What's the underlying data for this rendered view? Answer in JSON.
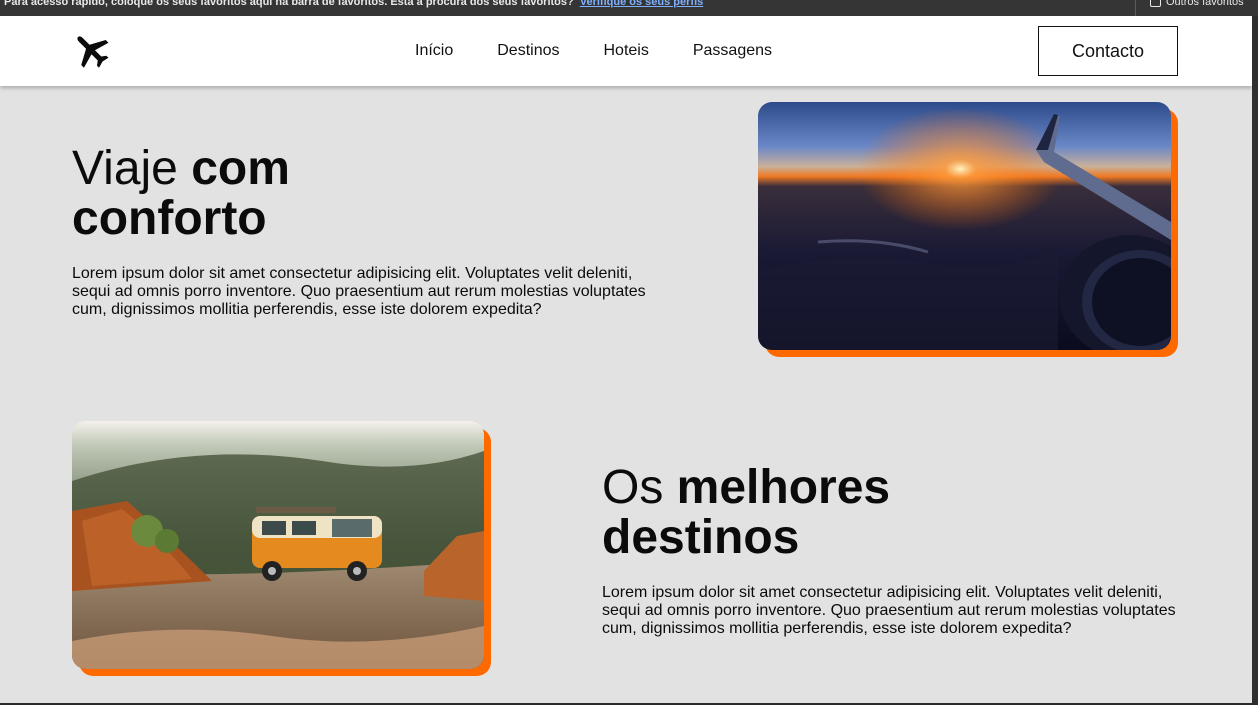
{
  "bookmarks_bar": {
    "message": "Para acesso rápido, coloque os seus favoritos aqui na barra de favoritos. Está à procura dos seus favoritos?",
    "link": "Verifique os seus perfis",
    "others": "Outros favoritos"
  },
  "nav": {
    "logo": "airplane-icon",
    "items": [
      {
        "label": "Início"
      },
      {
        "label": "Destinos"
      },
      {
        "label": "Hoteis"
      },
      {
        "label": "Passagens"
      }
    ],
    "contact_label": "Contacto"
  },
  "section1": {
    "title_light": "Viaje ",
    "title_bold": "com conforto",
    "text": "Lorem ipsum dolor sit amet consectetur adipisicing elit. Voluptates velit deleniti, sequi ad omnis porro inventore. Quo praesentium aut rerum molestias voluptates cum, dignissimos mollitia perferendis, esse iste dolorem expedita?",
    "image": "airplane-window-sunset-photo"
  },
  "section2": {
    "title_light": "Os ",
    "title_bold": "melhores destinos",
    "text": "Lorem ipsum dolor sit amet consectetur adipisicing elit. Voluptates velit deleniti, sequi ad omnis porro inventore. Quo praesentium aut rerum molestias voluptates cum, dignissimos mollitia perferendis, esse iste dolorem expedita?",
    "image": "orange-van-in-mountains-photo"
  },
  "colors": {
    "accent": "#ff6a00",
    "page_bg": "#e2e2e2",
    "header_bg": "#ffffff"
  }
}
